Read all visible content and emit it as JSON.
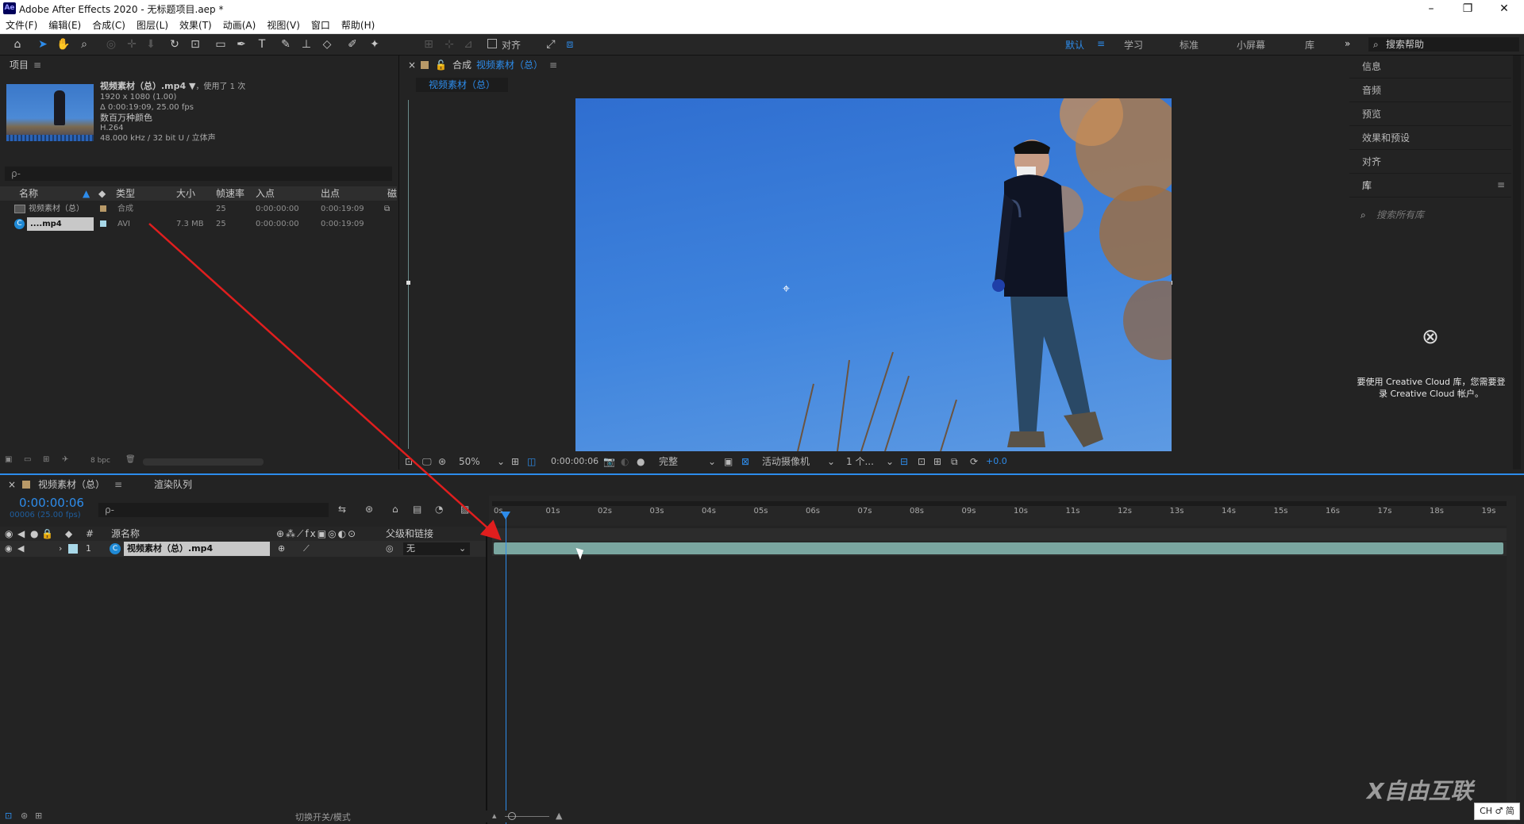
{
  "app": {
    "title": "Adobe After Effects 2020 - 无标题项目.aep *",
    "logo": "Ae"
  },
  "window_controls": {
    "minimize": "–",
    "restore": "❐",
    "close": "✕"
  },
  "menu": [
    "文件(F)",
    "编辑(E)",
    "合成(C)",
    "图层(L)",
    "效果(T)",
    "动画(A)",
    "视图(V)",
    "窗口",
    "帮助(H)"
  ],
  "toolbar": {
    "snap_label": "对齐",
    "workspaces": [
      {
        "label": "默认",
        "active": true
      },
      {
        "label": "学习"
      },
      {
        "label": "标准"
      },
      {
        "label": "小屏幕"
      },
      {
        "label": "库"
      }
    ],
    "overflow": "»",
    "help_search_placeholder": "搜索帮助"
  },
  "project": {
    "panel_title": "项目",
    "info": {
      "name": "视频素材（总）.mp4 ▼",
      "used": "，使用了 1 次",
      "resolution": "1920 x 1080 (1.00)",
      "duration": "Δ 0:00:19:09, 25.00 fps",
      "colors": "数百万种颜色",
      "codec": "H.264",
      "audio": "48.000 kHz / 32 bit U / 立体声"
    },
    "search_placeholder": "ρ-",
    "columns": [
      "名称",
      "类型",
      "大小",
      "帧速率",
      "入点",
      "出点",
      "磁"
    ],
    "rows": [
      {
        "name": "视频素材（总）",
        "type": "合成",
        "size": "",
        "fps": "25",
        "in": "0:00:00:00",
        "out": "0:00:19:09"
      },
      {
        "name": "....mp4",
        "type": "AVI",
        "size": "7.3 MB",
        "fps": "25",
        "in": "0:00:00:00",
        "out": "0:00:19:09"
      }
    ],
    "bpc": "8 bpc"
  },
  "composition": {
    "header_label": "合成",
    "comp_name": "视频素材（总）",
    "tab_name": "视频素材（总）",
    "zoom": "50%",
    "timecode": "0:00:00:06",
    "resolution": "完整",
    "camera": "活动摄像机",
    "views": "1 个...",
    "exposure": "+0.0"
  },
  "right_panel": {
    "items": [
      "信息",
      "音频",
      "预览",
      "效果和预设",
      "对齐",
      "库"
    ],
    "library_search_placeholder": "搜索所有库",
    "cc_message": "要使用 Creative Cloud 库，您需要登录 Creative Cloud 帐户。"
  },
  "timeline": {
    "tab_comp": "视频素材（总）",
    "tab_render": "渲染队列",
    "timecode": "0:00:00:06",
    "fps_line": "00006 (25.00 fps)",
    "search_placeholder": "ρ-",
    "col_source": "源名称",
    "col_parent": "父级和链接",
    "layer": {
      "index": "1",
      "name": "视频素材（总）.mp4",
      "parent": "无"
    },
    "ruler_ticks": [
      "0s",
      "01s",
      "02s",
      "03s",
      "04s",
      "05s",
      "06s",
      "07s",
      "08s",
      "09s",
      "10s",
      "11s",
      "12s",
      "13s",
      "14s",
      "15s",
      "16s",
      "17s",
      "18s",
      "19s"
    ],
    "footer_toggle": "切换开关/模式"
  },
  "overlay": {
    "watermark": "X自由互联",
    "ime": "CH ♂ 简"
  },
  "colors": {
    "accent": "#2d8ceb",
    "arrow": "#e01e1e",
    "layer_bar": "#7aa6a0"
  }
}
